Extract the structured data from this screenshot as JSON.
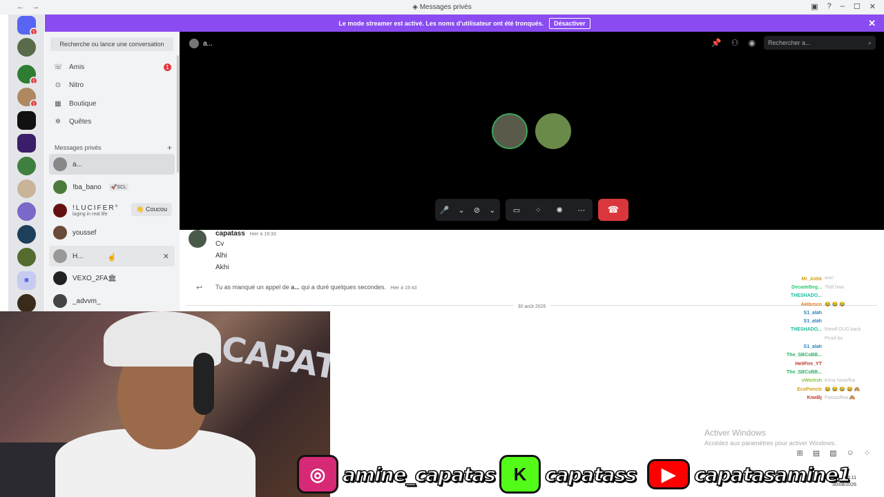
{
  "window": {
    "title": "Messages privés",
    "nav_arrows": "← →"
  },
  "banner": {
    "text": "Le mode streamer est activé. Les noms d'utilisateur ont été tronqués.",
    "button": "Désactiver",
    "close": "✕"
  },
  "sidebar": {
    "search_placeholder": "Recherche ou lance une conversation",
    "nav": [
      {
        "label": "Amis",
        "badge": "1"
      },
      {
        "label": "Nitro"
      },
      {
        "label": "Boutique"
      },
      {
        "label": "Quêtes"
      }
    ],
    "dm_header": "Messages privés",
    "dm_add": "+",
    "dms": [
      {
        "name": "a..."
      },
      {
        "name": "!ba_bano",
        "tag": "🚀SCL"
      },
      {
        "name": "!LUCIFER°",
        "sub": "laging in real life",
        "action": "👋 Coucou"
      },
      {
        "name": "youssef"
      },
      {
        "name": "H...",
        "close": "✕"
      },
      {
        "name": "VEXO_2FA🏛"
      },
      {
        "name": "_advvm_"
      }
    ]
  },
  "server_badges": [
    "1",
    "1",
    "1"
  ],
  "call": {
    "name": "a...",
    "search_placeholder": "Rechercher a...",
    "search_icon": "⌕",
    "header_icons": [
      "pin-icon",
      "add-friend-icon",
      "status-icon"
    ]
  },
  "chat": {
    "author": "capatass",
    "time": "Hier à 19:33",
    "lines": [
      "Cv",
      "Alhi",
      "Akhi"
    ],
    "missed_prefix": "Tu as manqué un appel de ",
    "missed_user": "a...",
    "missed_suffix": " qui a duré quelques secondes.",
    "missed_time": "Hier à 19:43",
    "date_separator": "30 août 2026"
  },
  "overlay_chat": [
    {
      "name": "Mr_Aldik",
      "color": "#d4a017",
      "text": "ᵂᴴᴬᵀ"
    },
    {
      "name": "DecadeBeg...",
      "color": "#2ecc71",
      "text": "Tkitf hwa"
    },
    {
      "name": "THESHADO...",
      "color": "#1abc9c",
      "text": ""
    },
    {
      "name": "Aklbroco",
      "color": "#e67e22",
      "text": "😂 😂 😂"
    },
    {
      "name": "S1_alah",
      "color": "#2980b9",
      "text": ""
    },
    {
      "name": "S1_alah",
      "color": "#2980b9",
      "text": ""
    },
    {
      "name": "THESHADO...",
      "color": "#1abc9c",
      "text": "Mewlf DUG back"
    },
    {
      "name": "",
      "color": "#999999",
      "text": "Proof bu"
    },
    {
      "name": "S1_alah",
      "color": "#2980b9",
      "text": ""
    },
    {
      "name": "The_SBCsBB...",
      "color": "#27ae60",
      "text": ""
    },
    {
      "name": "HellFire_YT",
      "color": "#c0392b",
      "text": ""
    },
    {
      "name": "The_SBCsBB...",
      "color": "#27ae60",
      "text": ""
    },
    {
      "name": "xWorksh",
      "color": "#8bc34a",
      "text": "Kima Nwarfha"
    },
    {
      "name": "EcoPoncle",
      "color": "#d4a017",
      "text": "😂 😂 😂 😂 🙈"
    },
    {
      "name": "KiwiBj",
      "color": "#c0392b",
      "text": "Pastaslfwa 🙈"
    }
  ],
  "watermark": {
    "title": "Activer Windows",
    "subtitle": "Accédez aux paramètres pour activer Windows."
  },
  "webcam": {
    "wall_text": "CAPAT"
  },
  "socials": [
    {
      "platform": "instagram",
      "handle": "amine_capatas",
      "icon": "◎",
      "color": "#d62976"
    },
    {
      "platform": "kick",
      "handle": "capatass",
      "icon": "K",
      "color": "#53fc18"
    },
    {
      "platform": "youtube",
      "handle": "capatasamine1",
      "icon": "▶",
      "color": "#ff0000"
    }
  ],
  "clock": {
    "time": "06:11",
    "date": "30/08/2026"
  }
}
